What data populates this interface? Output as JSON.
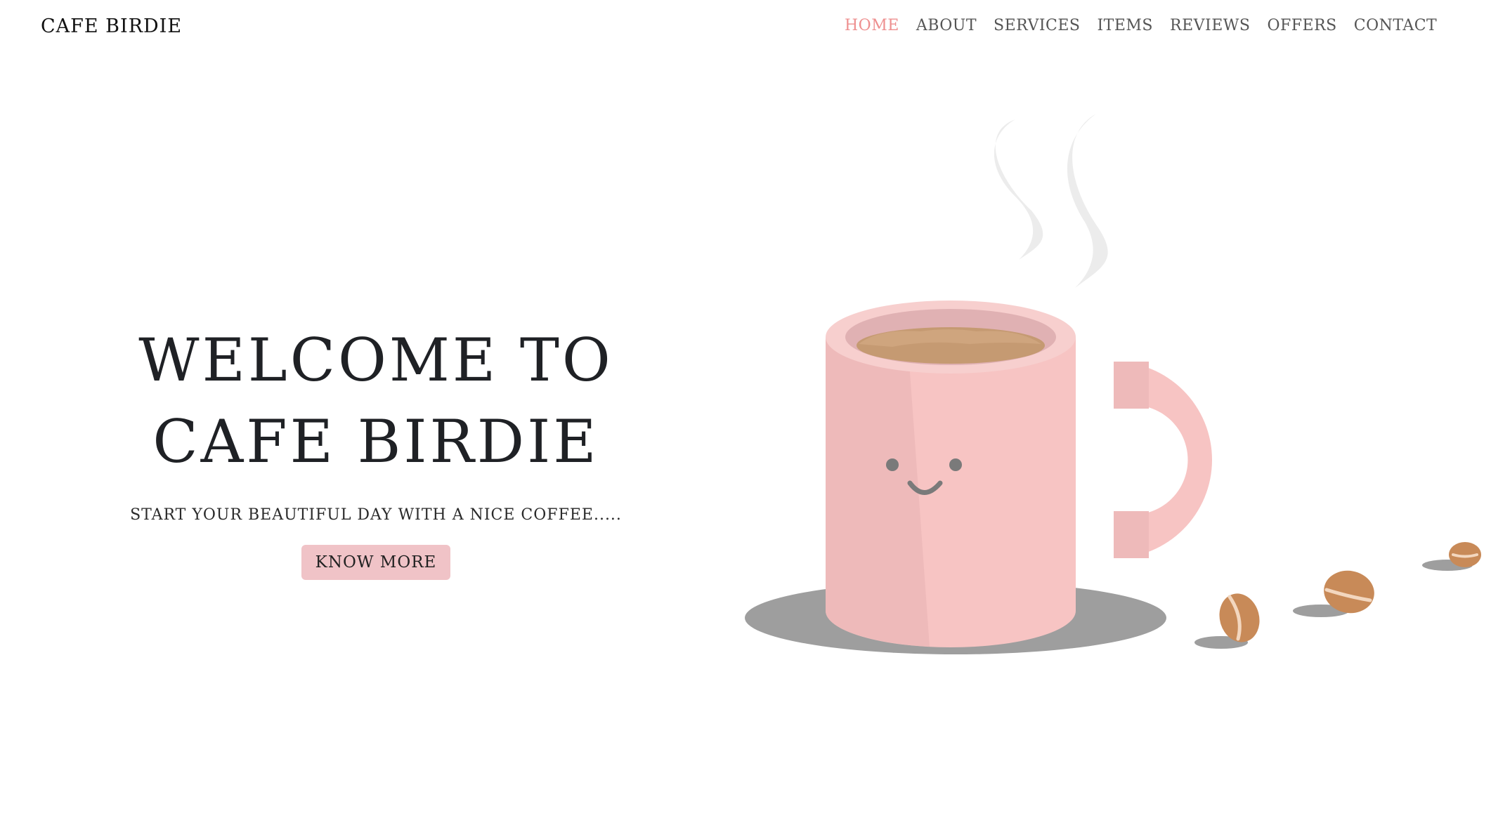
{
  "brand": {
    "name": "CAFE BIRDIE"
  },
  "nav": {
    "items": [
      {
        "label": "HOME",
        "active": true
      },
      {
        "label": "ABOUT"
      },
      {
        "label": "SERVICES"
      },
      {
        "label": "ITEMS"
      },
      {
        "label": "REVIEWS"
      },
      {
        "label": "OFFERS"
      },
      {
        "label": "CONTACT"
      }
    ]
  },
  "hero": {
    "title_line1": "WELCOME TO",
    "title_line2": "CAFE BIRDIE",
    "subtitle": "START YOUR BEAUTIFUL DAY WITH A NICE COFFEE.....",
    "cta_label": "KNOW MORE"
  },
  "illustration": {
    "icon": "coffee-mug-illustration",
    "colors": {
      "mug": "#f7c4c3",
      "mug_shade": "#eebaba",
      "coffee": "#c59a72",
      "bean": "#c88a58",
      "shadow": "#9e9e9e",
      "steam": "#ececec"
    }
  },
  "colors": {
    "accent": "#ee8f8f",
    "button_bg": "#f0c3c7",
    "text": "#1f2125"
  }
}
